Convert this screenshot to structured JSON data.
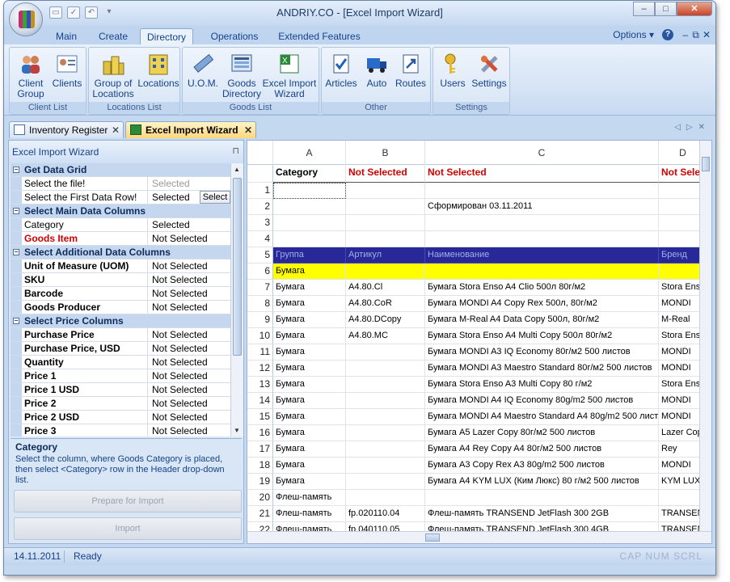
{
  "window": {
    "title": "ANDRIY.CO - [Excel Import Wizard]",
    "min": "–",
    "max": "□",
    "close": "✕"
  },
  "ribbon_tabs": [
    {
      "label": "Main"
    },
    {
      "label": "Create"
    },
    {
      "label": "Directory"
    },
    {
      "label": "Operations"
    },
    {
      "label": "Extended Features"
    }
  ],
  "ribbon_right": {
    "options": "Options ▾",
    "help": "?",
    "restore": "⧉",
    "close": "✕"
  },
  "groups": [
    {
      "label": "Client List",
      "buttons": [
        {
          "label": "Client\nGroup"
        },
        {
          "label": "Clients"
        }
      ]
    },
    {
      "label": "Locations List",
      "buttons": [
        {
          "label": "Group of\nLocations"
        },
        {
          "label": "Locations"
        }
      ]
    },
    {
      "label": "Goods List",
      "buttons": [
        {
          "label": "U.O.M."
        },
        {
          "label": "Goods\nDirectory"
        },
        {
          "label": "Excel Import\nWizard"
        }
      ]
    },
    {
      "label": "Other",
      "buttons": [
        {
          "label": "Articles"
        },
        {
          "label": "Auto"
        },
        {
          "label": "Routes"
        }
      ]
    },
    {
      "label": "Settings",
      "buttons": [
        {
          "label": "Users"
        },
        {
          "label": "Settings"
        }
      ]
    }
  ],
  "doc_tabs": [
    {
      "label": "Inventory Register",
      "close": "✕"
    },
    {
      "label": "Excel Import Wizard",
      "close": "✕"
    }
  ],
  "left_panel": {
    "title": "Excel Import Wizard",
    "pin": "⊓",
    "rows": [
      {
        "type": "cat",
        "label": "Get Data Grid"
      },
      {
        "label": "Select the file!",
        "value": "Selected",
        "style": "normal",
        "vstyle": "gray"
      },
      {
        "label": "Select the First Data Row!",
        "value": "Selected",
        "style": "normal",
        "button": "Select"
      },
      {
        "type": "cat",
        "label": "Select Main Data Columns"
      },
      {
        "label": "Category",
        "value": "Selected",
        "style": "normal"
      },
      {
        "label": "Goods Item",
        "value": "Not Selected",
        "style": "red"
      },
      {
        "type": "cat",
        "label": "Select Additional Data Columns"
      },
      {
        "label": "Unit of Measure (UOM)",
        "value": "Not Selected",
        "style": "bold"
      },
      {
        "label": "SKU",
        "value": "Not Selected",
        "style": "bold"
      },
      {
        "label": "Barcode",
        "value": "Not Selected",
        "style": "bold"
      },
      {
        "label": "Goods Producer",
        "value": "Not Selected",
        "style": "bold"
      },
      {
        "type": "cat",
        "label": "Select Price Columns"
      },
      {
        "label": "Purchase Price",
        "value": "Not Selected",
        "style": "bold"
      },
      {
        "label": "Purchase Price, USD",
        "value": "Not Selected",
        "style": "bold"
      },
      {
        "label": "Quantity",
        "value": "Not Selected",
        "style": "bold"
      },
      {
        "label": "Price 1",
        "value": "Not Selected",
        "style": "bold"
      },
      {
        "label": "Price 1 USD",
        "value": "Not Selected",
        "style": "bold"
      },
      {
        "label": "Price 2",
        "value": "Not Selected",
        "style": "bold"
      },
      {
        "label": "Price 2 USD",
        "value": "Not Selected",
        "style": "bold"
      },
      {
        "label": "Price 3",
        "value": "Not Selected",
        "style": "bold"
      }
    ],
    "desc_title": "Category",
    "desc_text": "Select the column, where Goods Category is placed, then select <Category> row in the Header drop-down list.",
    "prepare_button": "Prepare for Import",
    "import_button": "Import"
  },
  "sheet": {
    "columns": [
      {
        "letter": "A",
        "header": "Category",
        "hstyle": "black"
      },
      {
        "letter": "B",
        "header": "Not Selected",
        "hstyle": "red"
      },
      {
        "letter": "C",
        "header": "Not Selected",
        "hstyle": "red"
      },
      {
        "letter": "D",
        "header": "Not Selected",
        "hstyle": "red"
      }
    ],
    "rows": [
      {
        "n": "1",
        "cells": [
          "",
          "",
          "",
          ""
        ]
      },
      {
        "n": "2",
        "cells": [
          "",
          "",
          "Сформирован 03.11.2011",
          ""
        ]
      },
      {
        "n": "3",
        "cells": [
          "",
          "",
          "",
          ""
        ]
      },
      {
        "n": "4",
        "cells": [
          "",
          "",
          "",
          ""
        ]
      },
      {
        "n": "5",
        "style": "header",
        "cells": [
          "Группа",
          "Артикул",
          "Наименование",
          "Бренд"
        ]
      },
      {
        "n": "6",
        "style": "yellow",
        "cells": [
          "Бумага",
          "",
          "",
          ""
        ]
      },
      {
        "n": "7",
        "cells": [
          "Бумага",
          "A4.80.Cl",
          "Бумага Stora Enso A4 Clio 500л 80г/м2",
          "Stora Enso"
        ]
      },
      {
        "n": "8",
        "cells": [
          "Бумага",
          "A4.80.CoR",
          "Бумага MONDI A4 Copy Rex 500л, 80г/м2",
          "MONDI"
        ]
      },
      {
        "n": "9",
        "cells": [
          "Бумага",
          "A4.80.DCopy",
          "Бумага M-Real A4 Data Copy 500л, 80г/м2",
          "M-Real"
        ]
      },
      {
        "n": "10",
        "cells": [
          "Бумага",
          "A4.80.MC",
          "Бумага Stora Enso A4 Multi Copy 500л 80г/м2",
          "Stora Enso"
        ]
      },
      {
        "n": "11",
        "cells": [
          "Бумага",
          "",
          "Бумага MONDI A3 IQ Economy 80г/м2 500 листов",
          "MONDI"
        ]
      },
      {
        "n": "12",
        "cells": [
          "Бумага",
          "",
          "Бумага MONDI A3 Maestro Standard 80г/м2 500 листов",
          "MONDI"
        ]
      },
      {
        "n": "13",
        "cells": [
          "Бумага",
          "",
          "Бумага Stora Enso A3 Multi Copy 80 г/м2",
          "Stora Enso"
        ]
      },
      {
        "n": "14",
        "cells": [
          "Бумага",
          "",
          "Бумага MONDI A4 IQ Economy 80g/m2 500 листов",
          "MONDI"
        ]
      },
      {
        "n": "15",
        "cells": [
          "Бумага",
          "",
          "Бумага MONDI A4 Maestro Standard A4 80g/m2 500 лист",
          "MONDI"
        ]
      },
      {
        "n": "16",
        "cells": [
          "Бумага",
          "",
          "Бумага A5 Lazer Copy 80г/м2 500 листов",
          "Lazer Copy"
        ]
      },
      {
        "n": "17",
        "cells": [
          "Бумага",
          "",
          "Бумага A4 Rey Copy A4 80г/м2 500 листов",
          "Rey"
        ]
      },
      {
        "n": "18",
        "cells": [
          "Бумага",
          "",
          "Бумага A3 Copy Rex A3 80g/m2 500 листов",
          "MONDI"
        ]
      },
      {
        "n": "19",
        "cells": [
          "Бумага",
          "",
          "Бумага A4 KYM LUX (Ким Люкс) 80 г/м2 500 листов",
          "KYM LUX"
        ]
      },
      {
        "n": "20",
        "cells": [
          "Флеш-память",
          "",
          "",
          ""
        ]
      },
      {
        "n": "21",
        "cells": [
          "Флеш-память",
          "fp.020110.04",
          "Флеш-память TRANSEND JetFlash 300 2GB",
          "TRANSEND"
        ]
      },
      {
        "n": "22",
        "cells": [
          "Флеш-память",
          "fp.040110.05",
          "Флеш-память TRANSEND JetFlash 300 4GB",
          "TRANSEND"
        ]
      }
    ]
  },
  "status": {
    "date": "14.11.2011",
    "state": "Ready",
    "right": "CAP  NUM  SCRL"
  },
  "colors": {
    "header_row": "#282898",
    "yellow_row": "#ffff00",
    "red_text": "#d00000"
  }
}
